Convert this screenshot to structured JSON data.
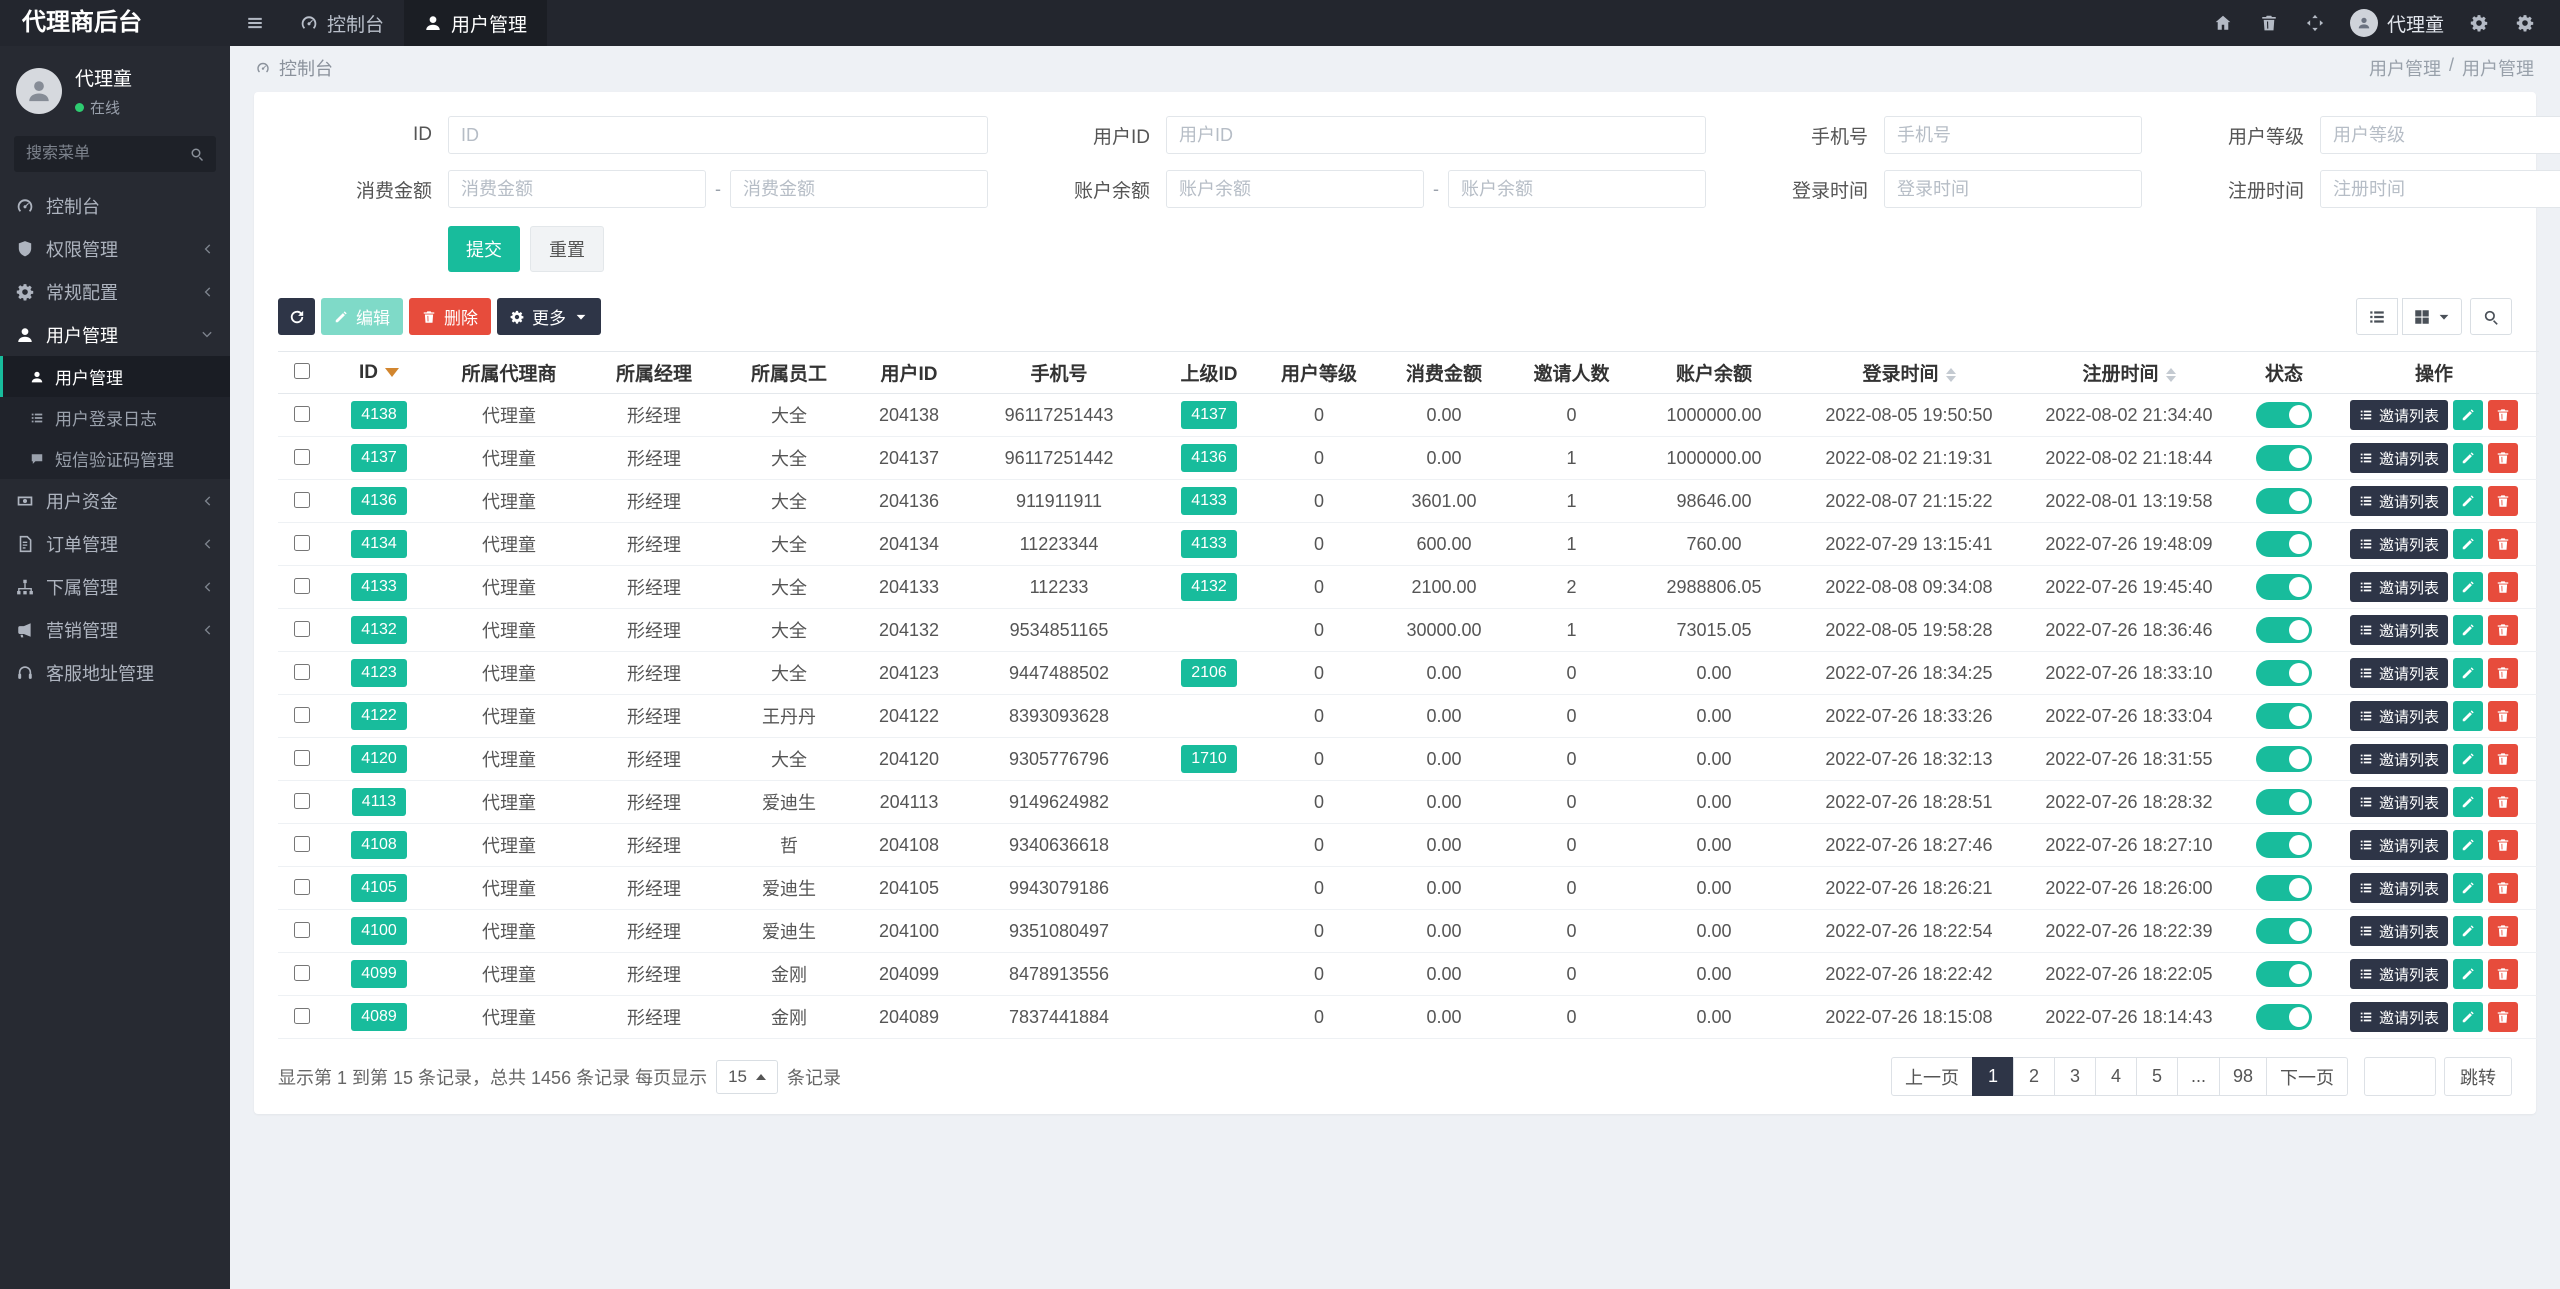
{
  "colors": {
    "accent": "#18bc9c",
    "danger": "#e74c3c",
    "dark_navy": "#2e3547",
    "topbar_bg": "#23262e",
    "sidebar_bg": "#272a32",
    "page_bg": "#eef1f5",
    "sort_active": "#d2862f"
  },
  "icons": {
    "hamburger": "menu-bars",
    "dashboard": "gauge",
    "user": "person",
    "home": "house",
    "trash": "trash-can",
    "fullscreen": "arrows-out",
    "settings": "gear",
    "search": "magnifier",
    "chevron_collapsed": "angle-left",
    "chevron_expanded": "angle-down",
    "refresh": "circular-arrow",
    "edit": "pencil",
    "delete": "trash-can",
    "more": "gear",
    "invite_list": "list",
    "view_list": "list",
    "view_grid": "grid",
    "permissions": "shield",
    "funds": "banknote",
    "orders": "document",
    "subordinates": "sitemap",
    "marketing": "bullhorn",
    "support": "headset",
    "sms": "comment"
  },
  "topbar": {
    "brand": "代理商后台",
    "tabs": [
      {
        "label": "控制台",
        "active": false
      },
      {
        "label": "用户管理",
        "active": true
      }
    ],
    "user_name": "代理童"
  },
  "sidebar": {
    "profile": {
      "name": "代理童",
      "status": "在线"
    },
    "search_placeholder": "搜索菜单",
    "items": [
      {
        "label": "控制台"
      },
      {
        "label": "权限管理"
      },
      {
        "label": "常规配置"
      },
      {
        "label": "用户管理",
        "children": [
          {
            "label": "用户管理"
          },
          {
            "label": "用户登录日志"
          },
          {
            "label": "短信验证码管理"
          }
        ]
      },
      {
        "label": "用户资金"
      },
      {
        "label": "订单管理"
      },
      {
        "label": "下属管理"
      },
      {
        "label": "营销管理"
      },
      {
        "label": "客服地址管理"
      }
    ]
  },
  "breadcrumb": {
    "left": "控制台",
    "section": "用户管理",
    "separator": "/",
    "page": "用户管理"
  },
  "filters": {
    "id": {
      "label": "ID",
      "placeholder": "ID"
    },
    "user_id": {
      "label": "用户ID",
      "placeholder": "用户ID"
    },
    "phone": {
      "label": "手机号",
      "placeholder": "手机号"
    },
    "level": {
      "label": "用户等级",
      "placeholder": "用户等级"
    },
    "consume": {
      "label": "消费金额",
      "placeholder": "消费金额"
    },
    "balance": {
      "label": "账户余额",
      "placeholder": "账户余额"
    },
    "login_time": {
      "label": "登录时间",
      "placeholder": "登录时间"
    },
    "register_time": {
      "label": "注册时间",
      "placeholder": "注册时间"
    },
    "range_separator": "-",
    "submit": "提交",
    "reset": "重置"
  },
  "toolbar": {
    "edit": "编辑",
    "delete": "删除",
    "more": "更多"
  },
  "table": {
    "columns": [
      "ID",
      "所属代理商",
      "所属经理",
      "所属员工",
      "用户ID",
      "手机号",
      "上级ID",
      "用户等级",
      "消费金额",
      "邀请人数",
      "账户余额",
      "登录时间",
      "注册时间",
      "状态",
      "操作"
    ],
    "invite_label": "邀请列表",
    "rows": [
      {
        "id": "4138",
        "agent": "代理童",
        "manager": "形经理",
        "staff": "大全",
        "user_id": "204138",
        "phone": "96117251443",
        "parent_id": "4137",
        "level": "0",
        "consume": "0.00",
        "invites": "0",
        "balance": "1000000.00",
        "login_time": "2022-08-05 19:50:50",
        "register_time": "2022-08-02 21:34:40",
        "status": true
      },
      {
        "id": "4137",
        "agent": "代理童",
        "manager": "形经理",
        "staff": "大全",
        "user_id": "204137",
        "phone": "96117251442",
        "parent_id": "4136",
        "level": "0",
        "consume": "0.00",
        "invites": "1",
        "balance": "1000000.00",
        "login_time": "2022-08-02 21:19:31",
        "register_time": "2022-08-02 21:18:44",
        "status": true
      },
      {
        "id": "4136",
        "agent": "代理童",
        "manager": "形经理",
        "staff": "大全",
        "user_id": "204136",
        "phone": "911911911",
        "parent_id": "4133",
        "level": "0",
        "consume": "3601.00",
        "invites": "1",
        "balance": "98646.00",
        "login_time": "2022-08-07 21:15:22",
        "register_time": "2022-08-01 13:19:58",
        "status": true
      },
      {
        "id": "4134",
        "agent": "代理童",
        "manager": "形经理",
        "staff": "大全",
        "user_id": "204134",
        "phone": "11223344",
        "parent_id": "4133",
        "level": "0",
        "consume": "600.00",
        "invites": "1",
        "balance": "760.00",
        "login_time": "2022-07-29 13:15:41",
        "register_time": "2022-07-26 19:48:09",
        "status": true
      },
      {
        "id": "4133",
        "agent": "代理童",
        "manager": "形经理",
        "staff": "大全",
        "user_id": "204133",
        "phone": "112233",
        "parent_id": "4132",
        "level": "0",
        "consume": "2100.00",
        "invites": "2",
        "balance": "2988806.05",
        "login_time": "2022-08-08 09:34:08",
        "register_time": "2022-07-26 19:45:40",
        "status": true
      },
      {
        "id": "4132",
        "agent": "代理童",
        "manager": "形经理",
        "staff": "大全",
        "user_id": "204132",
        "phone": "9534851165",
        "parent_id": "",
        "level": "0",
        "consume": "30000.00",
        "invites": "1",
        "balance": "73015.05",
        "login_time": "2022-08-05 19:58:28",
        "register_time": "2022-07-26 18:36:46",
        "status": true
      },
      {
        "id": "4123",
        "agent": "代理童",
        "manager": "形经理",
        "staff": "大全",
        "user_id": "204123",
        "phone": "9447488502",
        "parent_id": "2106",
        "level": "0",
        "consume": "0.00",
        "invites": "0",
        "balance": "0.00",
        "login_time": "2022-07-26 18:34:25",
        "register_time": "2022-07-26 18:33:10",
        "status": true
      },
      {
        "id": "4122",
        "agent": "代理童",
        "manager": "形经理",
        "staff": "王丹丹",
        "user_id": "204122",
        "phone": "8393093628",
        "parent_id": "",
        "level": "0",
        "consume": "0.00",
        "invites": "0",
        "balance": "0.00",
        "login_time": "2022-07-26 18:33:26",
        "register_time": "2022-07-26 18:33:04",
        "status": true
      },
      {
        "id": "4120",
        "agent": "代理童",
        "manager": "形经理",
        "staff": "大全",
        "user_id": "204120",
        "phone": "9305776796",
        "parent_id": "1710",
        "level": "0",
        "consume": "0.00",
        "invites": "0",
        "balance": "0.00",
        "login_time": "2022-07-26 18:32:13",
        "register_time": "2022-07-26 18:31:55",
        "status": true
      },
      {
        "id": "4113",
        "agent": "代理童",
        "manager": "形经理",
        "staff": "爱迪生",
        "user_id": "204113",
        "phone": "9149624982",
        "parent_id": "",
        "level": "0",
        "consume": "0.00",
        "invites": "0",
        "balance": "0.00",
        "login_time": "2022-07-26 18:28:51",
        "register_time": "2022-07-26 18:28:32",
        "status": true
      },
      {
        "id": "4108",
        "agent": "代理童",
        "manager": "形经理",
        "staff": "哲",
        "user_id": "204108",
        "phone": "9340636618",
        "parent_id": "",
        "level": "0",
        "consume": "0.00",
        "invites": "0",
        "balance": "0.00",
        "login_time": "2022-07-26 18:27:46",
        "register_time": "2022-07-26 18:27:10",
        "status": true
      },
      {
        "id": "4105",
        "agent": "代理童",
        "manager": "形经理",
        "staff": "爱迪生",
        "user_id": "204105",
        "phone": "9943079186",
        "parent_id": "",
        "level": "0",
        "consume": "0.00",
        "invites": "0",
        "balance": "0.00",
        "login_time": "2022-07-26 18:26:21",
        "register_time": "2022-07-26 18:26:00",
        "status": true
      },
      {
        "id": "4100",
        "agent": "代理童",
        "manager": "形经理",
        "staff": "爱迪生",
        "user_id": "204100",
        "phone": "9351080497",
        "parent_id": "",
        "level": "0",
        "consume": "0.00",
        "invites": "0",
        "balance": "0.00",
        "login_time": "2022-07-26 18:22:54",
        "register_time": "2022-07-26 18:22:39",
        "status": true
      },
      {
        "id": "4099",
        "agent": "代理童",
        "manager": "形经理",
        "staff": "金刚",
        "user_id": "204099",
        "phone": "8478913556",
        "parent_id": "",
        "level": "0",
        "consume": "0.00",
        "invites": "0",
        "balance": "0.00",
        "login_time": "2022-07-26 18:22:42",
        "register_time": "2022-07-26 18:22:05",
        "status": true
      },
      {
        "id": "4089",
        "agent": "代理童",
        "manager": "形经理",
        "staff": "金刚",
        "user_id": "204089",
        "phone": "7837441884",
        "parent_id": "",
        "level": "0",
        "consume": "0.00",
        "invites": "0",
        "balance": "0.00",
        "login_time": "2022-07-26 18:15:08",
        "register_time": "2022-07-26 18:14:43",
        "status": true
      }
    ]
  },
  "pagination": {
    "summary_prefix": "显示第 1 到第 15 条记录，总共 1456 条记录 每页显示",
    "per_page": "15",
    "summary_suffix": "条记录",
    "prev": "上一页",
    "next": "下一页",
    "pages": [
      {
        "label": "1",
        "active": true
      },
      {
        "label": "2"
      },
      {
        "label": "3"
      },
      {
        "label": "4"
      },
      {
        "label": "5"
      },
      {
        "label": "..."
      },
      {
        "label": "98"
      }
    ],
    "jump_label": "跳转"
  }
}
